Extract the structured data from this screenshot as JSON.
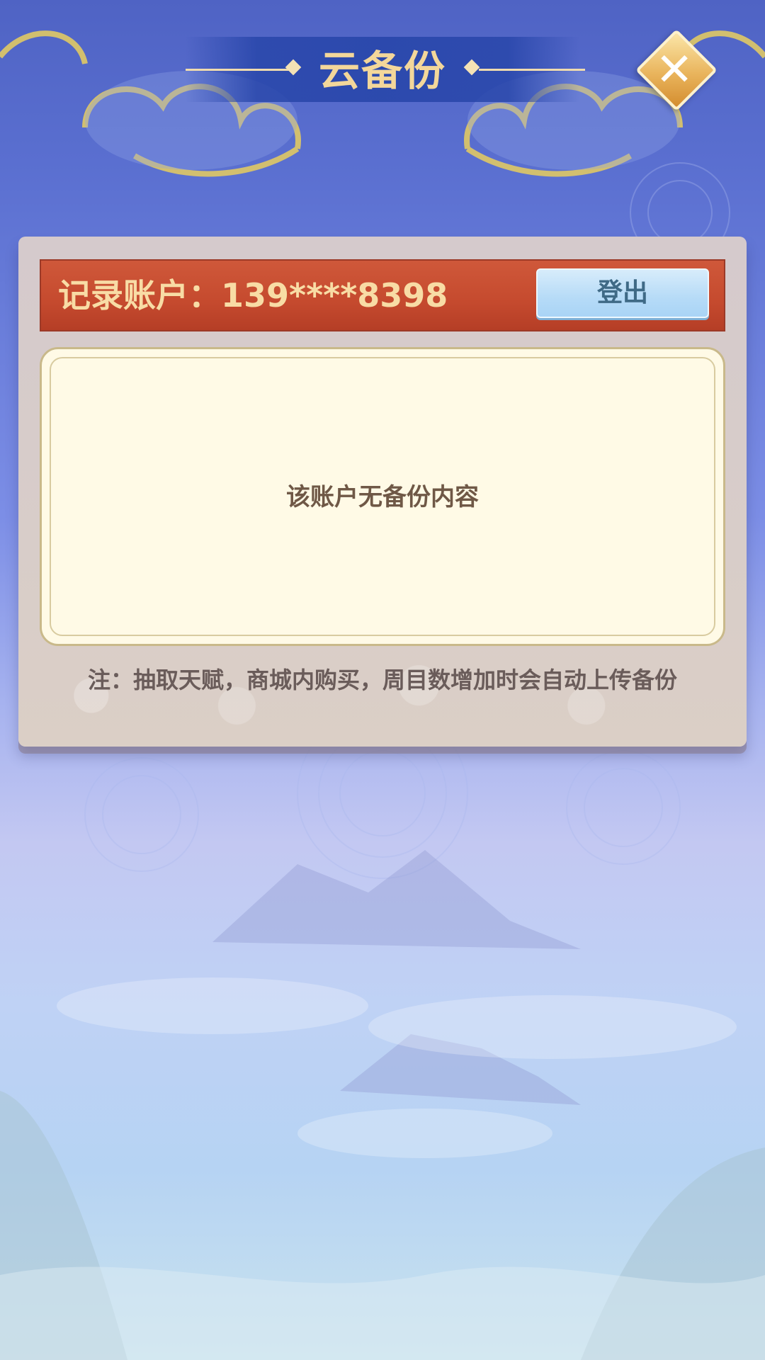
{
  "header": {
    "title": "云备份",
    "close_icon": "close-icon"
  },
  "account": {
    "label": "记录账户：139****8398",
    "logout_label": "登出"
  },
  "content": {
    "empty_message": "该账户无备份内容"
  },
  "note": {
    "text": "注：抽取天赋，商城内购买，周目数增加时会自动上传备份"
  },
  "colors": {
    "title": "#f3d79a",
    "account_bar": "#c54a2e",
    "account_text": "#f8dca5",
    "logout_button": "#b6dbf7",
    "content_bg": "#fffae6"
  }
}
